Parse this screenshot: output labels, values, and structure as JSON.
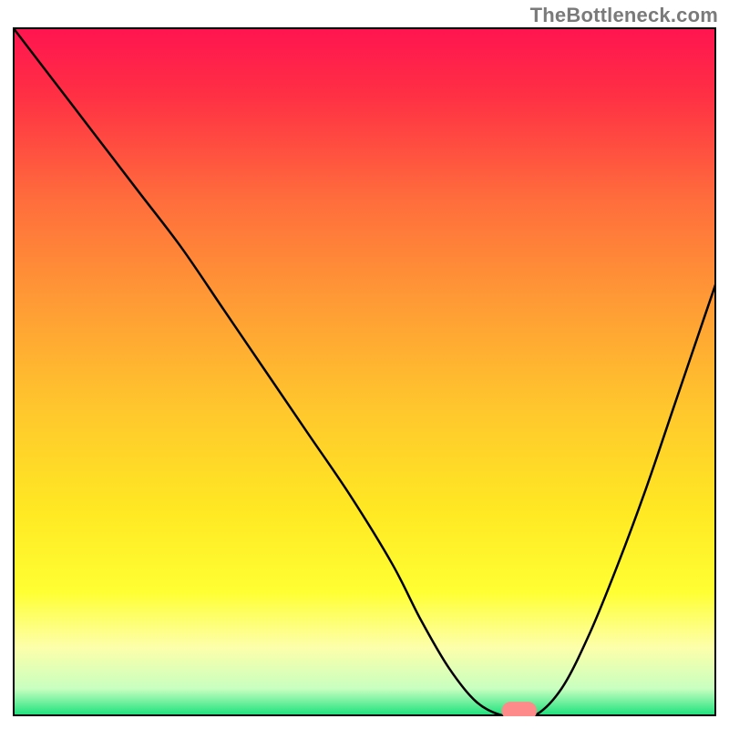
{
  "watermark": "TheBottleneck.com",
  "chart_data": {
    "type": "line",
    "title": "",
    "xlabel": "",
    "ylabel": "",
    "xlim": [
      0,
      100
    ],
    "ylim": [
      0,
      100
    ],
    "grid": false,
    "background": {
      "type": "vertical-gradient",
      "stops": [
        {
          "offset": 0.0,
          "color": "#ff1450"
        },
        {
          "offset": 0.1,
          "color": "#ff3044"
        },
        {
          "offset": 0.25,
          "color": "#ff6d3c"
        },
        {
          "offset": 0.4,
          "color": "#ff9b35"
        },
        {
          "offset": 0.55,
          "color": "#ffc62d"
        },
        {
          "offset": 0.7,
          "color": "#ffe823"
        },
        {
          "offset": 0.82,
          "color": "#ffff33"
        },
        {
          "offset": 0.9,
          "color": "#fdffaa"
        },
        {
          "offset": 0.96,
          "color": "#c8ffc0"
        },
        {
          "offset": 1.0,
          "color": "#15e07a"
        }
      ]
    },
    "series": [
      {
        "name": "bottleneck-curve",
        "color": "#000000",
        "x": [
          0,
          6,
          12,
          18,
          24,
          30,
          36,
          42,
          48,
          54,
          58,
          62,
          66,
          70,
          74,
          78,
          82,
          86,
          90,
          94,
          98,
          100
        ],
        "y": [
          100,
          92,
          84,
          76,
          68,
          59,
          50,
          41,
          32,
          22,
          14,
          7,
          2,
          0,
          0,
          4,
          12,
          22,
          33,
          45,
          57,
          63
        ]
      }
    ],
    "marker": {
      "name": "optimal-point",
      "x": 72,
      "y": 0.8,
      "color": "#ff8a8a",
      "width": 5,
      "height": 2.6
    }
  }
}
